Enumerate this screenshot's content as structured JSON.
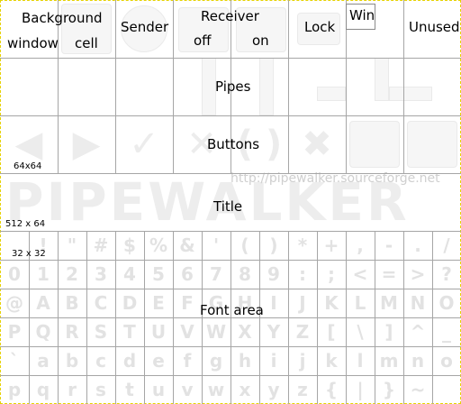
{
  "row0": {
    "background_window": "Background",
    "background_window_2": "window",
    "background_cell": "cell",
    "sender": "Sender",
    "receiver": "Receiver",
    "receiver_off": "off",
    "receiver_on": "on",
    "lock": "Lock",
    "win": "Win",
    "unused": "Unused"
  },
  "sections": {
    "pipes": "Pipes",
    "buttons": "Buttons",
    "title": "Title",
    "font_area": "Font area"
  },
  "size_labels": {
    "tile": "64x64",
    "title": "512 x 64",
    "font": "32 x 32"
  },
  "title_art": {
    "text": "PIPEWALKER",
    "url": "http://pipewalker.sourceforge.net"
  },
  "buttons_icons": [
    "arrow-left-icon",
    "arrow-right-icon",
    "check-icon",
    "cross-icon",
    "reload-icon",
    "settings-tools-icon",
    "blank-button-icon",
    "check-large-icon"
  ],
  "font_chars": [
    [
      " ",
      "!",
      "\"",
      "#",
      "$",
      "%",
      "&",
      "'",
      "(",
      ")",
      "*",
      "+",
      ",",
      "-",
      ".",
      "/"
    ],
    [
      "0",
      "1",
      "2",
      "3",
      "4",
      "5",
      "6",
      "7",
      "8",
      "9",
      ":",
      ";",
      "<",
      "=",
      ">",
      "?"
    ],
    [
      "@",
      "A",
      "B",
      "C",
      "D",
      "E",
      "F",
      "G",
      "H",
      "I",
      "J",
      "K",
      "L",
      "M",
      "N",
      "O"
    ],
    [
      "P",
      "Q",
      "R",
      "S",
      "T",
      "U",
      "V",
      "W",
      "X",
      "Y",
      "Z",
      "[",
      "\\",
      "]",
      "^",
      "_"
    ],
    [
      "`",
      "a",
      "b",
      "c",
      "d",
      "e",
      "f",
      "g",
      "h",
      "i",
      "j",
      "k",
      "l",
      "m",
      "n",
      "o"
    ],
    [
      "p",
      "q",
      "r",
      "s",
      "t",
      "u",
      "v",
      "w",
      "x",
      "y",
      "z",
      "{",
      "|",
      "}",
      "~",
      " "
    ]
  ]
}
